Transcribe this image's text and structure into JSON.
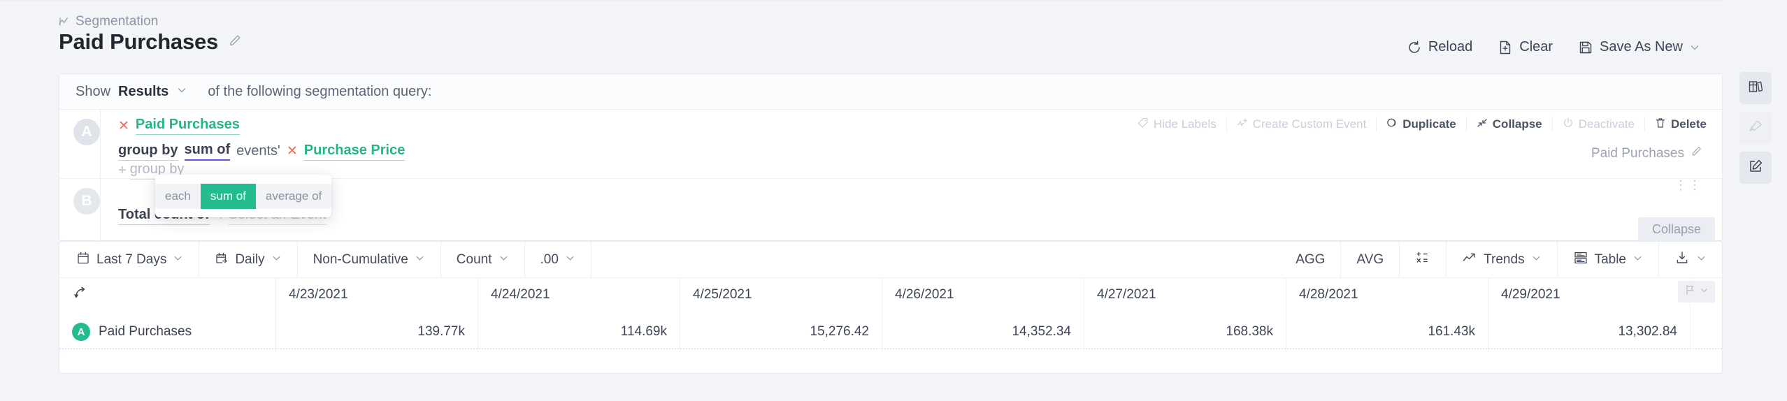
{
  "header": {
    "breadcrumb": "Segmentation",
    "breadcrumb_icon": "chart-line-icon",
    "title": "Paid Purchases",
    "title_edit_icon": "pencil-icon",
    "actions": [
      {
        "label": "Reload",
        "icon": "reload-icon"
      },
      {
        "label": "Clear",
        "icon": "file-plus-icon"
      },
      {
        "label": "Save As New",
        "icon": "save-disk-icon",
        "has_chevron": true
      }
    ]
  },
  "query": {
    "show_prefix": "Show",
    "show_value": "Results",
    "show_suffix": "of the following segmentation query:",
    "rows": [
      {
        "letter": "A",
        "event_name": "Paid Purchases",
        "remove_icon": "close-x-icon",
        "group_by_label": "group by",
        "aggregation": "sum of",
        "events_word": "events'",
        "property": "Purchase Price",
        "add_group_by": "group by",
        "add_group_by_plus": "+",
        "right_label": "Paid Purchases",
        "right_label_edit_icon": "pencil-icon",
        "tools": [
          {
            "label": "Hide Labels",
            "icon": "tag-icon",
            "enabled": false
          },
          {
            "label": "Create Custom Event",
            "icon": "custom-event-icon",
            "enabled": false
          },
          {
            "label": "Duplicate",
            "icon": "duplicate-icon",
            "enabled": true
          },
          {
            "label": "Collapse",
            "icon": "collapse-arrows-icon",
            "enabled": true
          },
          {
            "label": "Deactivate",
            "icon": "power-icon",
            "enabled": false
          },
          {
            "label": "Delete",
            "icon": "trash-icon",
            "enabled": true
          }
        ]
      },
      {
        "letter": "B",
        "total_label": "Total count of",
        "select_event_plus": "+",
        "select_event": "Select an Event",
        "collapse_pill": "Collapse"
      }
    ]
  },
  "popup": {
    "options": [
      "each",
      "sum of",
      "average of"
    ],
    "selected": "sum of",
    "selected_color": "#22bc8e"
  },
  "controls": {
    "left": [
      {
        "label": "Last 7 Days",
        "icon": "calendar-icon",
        "chevron": true
      },
      {
        "label": "Daily",
        "icon": "calendar-arrow-icon",
        "chevron": true
      },
      {
        "label": "Non-Cumulative",
        "icon": "",
        "chevron": true
      },
      {
        "label": "Count",
        "icon": "",
        "chevron": true
      },
      {
        "label": ".00",
        "icon": "",
        "chevron": true
      }
    ],
    "right": [
      {
        "label": "AGG",
        "icon": "",
        "chevron": false
      },
      {
        "label": "AVG",
        "icon": "",
        "chevron": false
      },
      {
        "label": "",
        "icon": "formula-icon",
        "chevron": false
      },
      {
        "label": "Trends",
        "icon": "trend-up-icon",
        "chevron": true
      },
      {
        "label": "Table",
        "icon": "table-icon",
        "chevron": true
      },
      {
        "label": "",
        "icon": "download-icon",
        "chevron": true
      }
    ]
  },
  "table": {
    "sort_icon": "sort-arrow-icon",
    "flag_icon": "flag-icon",
    "columns": [
      "4/23/2021",
      "4/24/2021",
      "4/25/2021",
      "4/26/2021",
      "4/27/2021",
      "4/28/2021",
      "4/29/2021"
    ],
    "rows": [
      {
        "badge": "A",
        "label": "Paid Purchases",
        "values": [
          "139.77k",
          "114.69k",
          "15,276.42",
          "14,352.34",
          "168.38k",
          "161.43k",
          "13,302.84"
        ]
      }
    ]
  },
  "rail": {
    "buttons": [
      {
        "icon": "library-books-icon",
        "state": "selected"
      },
      {
        "icon": "telescope-icon",
        "state": "dim"
      },
      {
        "icon": "edit-square-icon",
        "state": "selected"
      }
    ]
  },
  "chart_data": {
    "type": "table",
    "title": "Paid Purchases",
    "categories": [
      "4/23/2021",
      "4/24/2021",
      "4/25/2021",
      "4/26/2021",
      "4/27/2021",
      "4/28/2021",
      "4/29/2021"
    ],
    "series": [
      {
        "name": "Paid Purchases",
        "values": [
          139770,
          114690,
          15276.42,
          14352.34,
          168380,
          161430,
          13302.84
        ]
      }
    ],
    "xlabel": "",
    "ylabel": "",
    "legend": "left"
  }
}
